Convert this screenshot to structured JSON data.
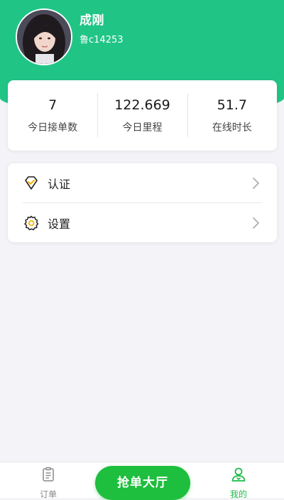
{
  "profile": {
    "name": "成刚",
    "id": "鲁c14253"
  },
  "stats": [
    {
      "value": "7",
      "label": "今日接单数"
    },
    {
      "value": "122.669",
      "label": "今日里程"
    },
    {
      "value": "51.7",
      "label": "在线时长"
    }
  ],
  "menu": [
    {
      "label": "认证",
      "icon": "certify-diamond-icon"
    },
    {
      "label": "设置",
      "icon": "gear-icon"
    }
  ],
  "nav": {
    "orders_label": "订单",
    "grab_label": "抢单大厅",
    "mine_label": "我的"
  },
  "colors": {
    "header_green": "#20c586",
    "button_green": "#1ebe3e",
    "active_nav": "#1dbb4a",
    "icon_yellow": "#f4b400"
  }
}
